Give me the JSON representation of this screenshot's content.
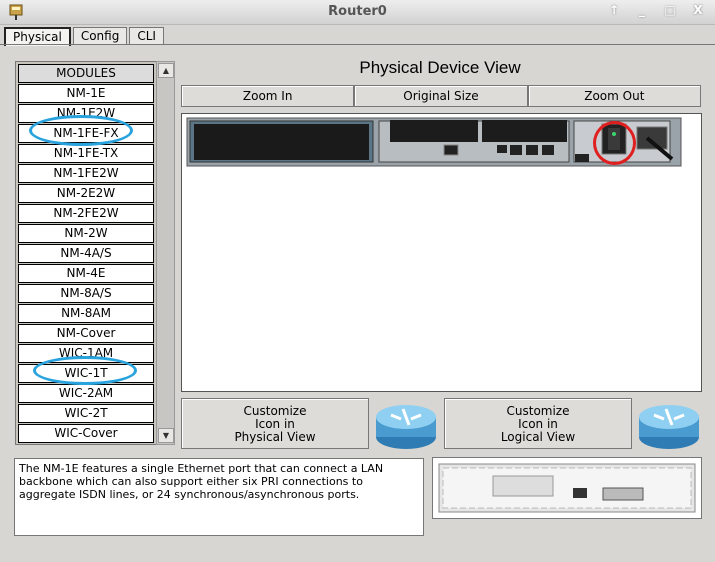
{
  "window": {
    "title": "Router0",
    "controls": [
      "↑",
      "_",
      "□",
      "X"
    ]
  },
  "tabs": [
    {
      "label": "Physical",
      "active": true
    },
    {
      "label": "Config",
      "active": false
    },
    {
      "label": "CLI",
      "active": false
    }
  ],
  "modules": {
    "header": "MODULES",
    "items": [
      "NM-1E",
      "NM-1E2W",
      "NM-1FE-FX",
      "NM-1FE-TX",
      "NM-1FE2W",
      "NM-2E2W",
      "NM-2FE2W",
      "NM-2W",
      "NM-4A/S",
      "NM-4E",
      "NM-8A/S",
      "NM-8AM",
      "NM-Cover",
      "WIC-1AM",
      "WIC-1T",
      "WIC-2AM",
      "WIC-2T",
      "WIC-Cover"
    ],
    "highlighted": [
      "NM-1FE-FX",
      "WIC-1T"
    ]
  },
  "physical_view": {
    "title": "Physical Device View",
    "zoom_in": "Zoom In",
    "original_size": "Original Size",
    "zoom_out": "Zoom Out"
  },
  "customize": {
    "physical": {
      "line1": "Customize",
      "line2": "Icon in",
      "line3": "Physical View"
    },
    "logical": {
      "line1": "Customize",
      "line2": "Icon in",
      "line3": "Logical View"
    }
  },
  "description": "The NM-1E features a single Ethernet port that can connect a LAN backbone which can also support either six PRI connections to aggregate ISDN lines, or 24 synchronous/asynchronous ports.",
  "colors": {
    "highlight_blue": "#29a3dd",
    "highlight_red": "#e02020",
    "router_blue": "#4a9bd0"
  }
}
